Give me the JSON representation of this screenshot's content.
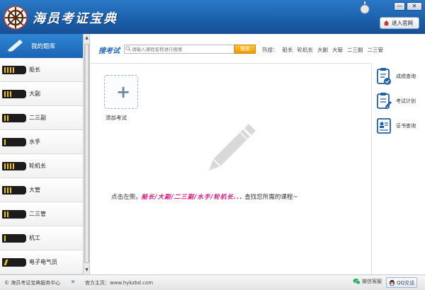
{
  "app": {
    "title": "海员考证宝典",
    "enter_site": "进入官网"
  },
  "window": {
    "minimize": "—",
    "close": "✕"
  },
  "sidebar": {
    "header": "我的题库",
    "items": [
      {
        "label": "船长"
      },
      {
        "label": "大副"
      },
      {
        "label": "二三副"
      },
      {
        "label": "水手"
      },
      {
        "label": "轮机长"
      },
      {
        "label": "大管"
      },
      {
        "label": "二三管"
      },
      {
        "label": "机工"
      },
      {
        "label": "电子电气员"
      }
    ]
  },
  "search": {
    "title": "搜考试",
    "placeholder": "请输入课程名称进行搜索",
    "button": "搜索",
    "hot_label": "热搜：",
    "hot_tags": [
      "船长",
      "轮机长",
      "大副",
      "大管",
      "二三副",
      "二三管"
    ]
  },
  "main": {
    "add_exam": "添加考试",
    "hint_prefix": "点击左侧，",
    "hint_highlight": "船长/大副/二三副/水手/轮机长...",
    "hint_suffix": "  查找您所需的课程~"
  },
  "right_panel": {
    "items": [
      {
        "label": "成绩查询"
      },
      {
        "label": "考试计划"
      },
      {
        "label": "证书查询"
      }
    ]
  },
  "footer": {
    "copyright": "© 海员考证宝典服务中心",
    "site": "官方主页：www.hykzbd.com",
    "wechat": "微信客服",
    "qq": "QQ交谈"
  },
  "colors": {
    "header_blue": "#1a5fab",
    "accent_pink": "#e0147d",
    "search_orange": "#f09a00",
    "rank_gold": "#f2c318"
  }
}
